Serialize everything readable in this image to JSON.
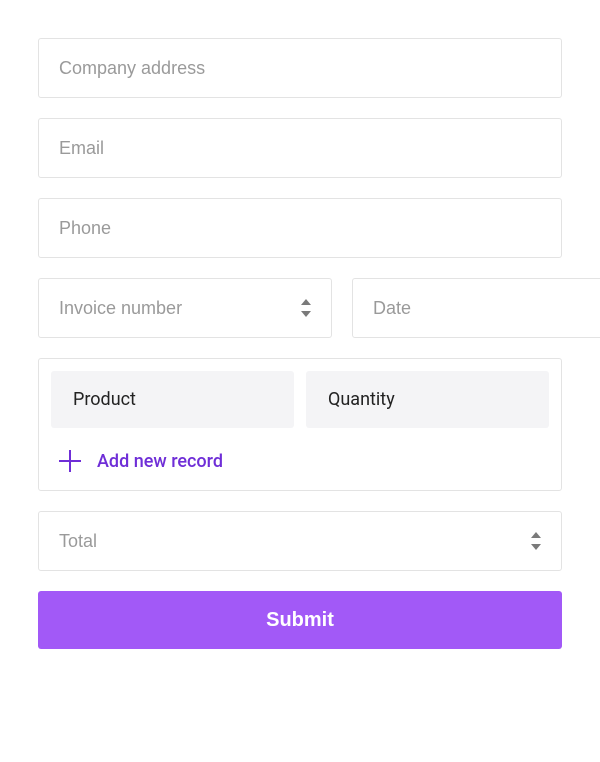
{
  "company_address_placeholder": "Company address",
  "email_placeholder": "Email",
  "phone_placeholder": "Phone",
  "invoice_number_placeholder": "Invoice number",
  "date_placeholder": "Date",
  "table": {
    "headers": {
      "product": "Product",
      "quantity": "Quantity"
    },
    "add_record_label": "Add new record"
  },
  "total_placeholder": "Total",
  "submit_label": "Submit"
}
